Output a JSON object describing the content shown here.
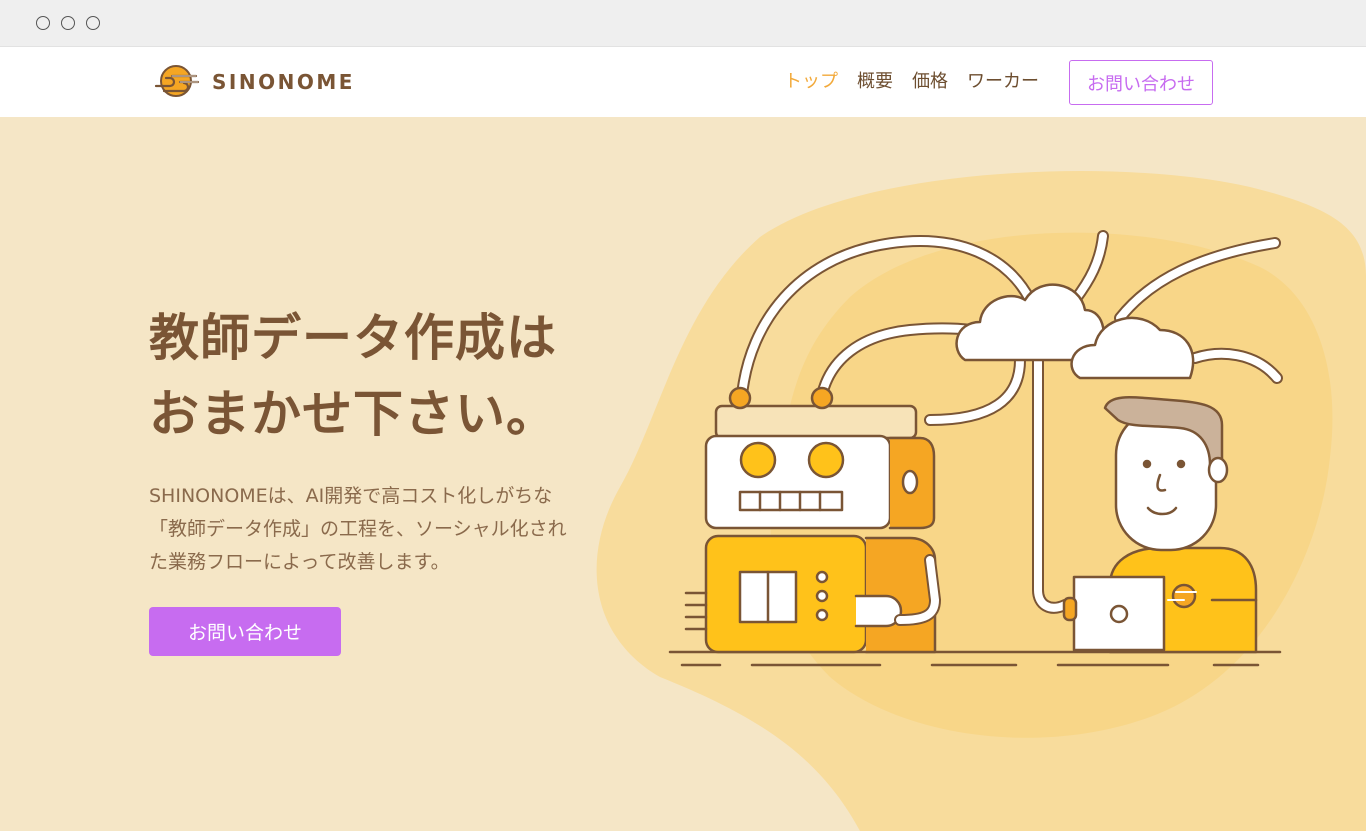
{
  "brand": {
    "name": "SINONOME",
    "accent": "#f2a93a",
    "text_color": "#7a5535",
    "cta_color": "#c76cf0",
    "hero_bg": "#f5e6c6"
  },
  "window_controls": [
    "circle-icon",
    "circle-icon",
    "circle-icon"
  ],
  "nav": {
    "items": [
      {
        "label": "トップ",
        "active": true
      },
      {
        "label": "概要",
        "active": false
      },
      {
        "label": "価格",
        "active": false
      },
      {
        "label": "ワーカー",
        "active": false
      }
    ],
    "contact_label": "お問い合わせ"
  },
  "hero": {
    "headline": [
      "教師データ作成は",
      "おまかせ下さい。"
    ],
    "body": [
      "SHINONOMEは、AI開発で高コスト化しがちな",
      "「教師データ作成」の工程を、ソーシャル化され",
      "た業務フローによって改善します。"
    ],
    "cta_label": "お問い合わせ"
  }
}
